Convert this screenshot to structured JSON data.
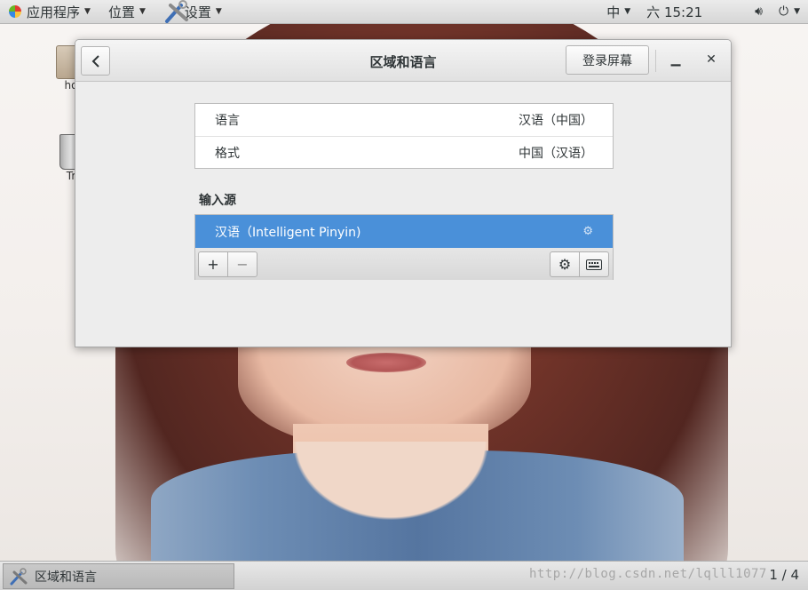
{
  "top_panel": {
    "applications": "应用程序",
    "places": "位置",
    "settings": "设置",
    "input_method": "中",
    "clock": "六 15:21"
  },
  "desktop": {
    "home_label": "ho",
    "trash_label": "Tr"
  },
  "dialog": {
    "title": "区域和语言",
    "login_screen_button": "登录屏幕",
    "language_label": "语言",
    "language_value": "汉语（中国）",
    "formats_label": "格式",
    "formats_value": "中国（汉语）",
    "input_sources_heading": "输入源",
    "input_sources": [
      {
        "label": "汉语（Intelligent Pinyin)"
      }
    ]
  },
  "bottom_panel": {
    "task_label": "区域和语言",
    "workspace": "1 / 4",
    "watermark": "http://blog.csdn.net/lqlll1077"
  },
  "colors": {
    "selection": "#4a90d9",
    "dialog_bg": "#ededed"
  }
}
